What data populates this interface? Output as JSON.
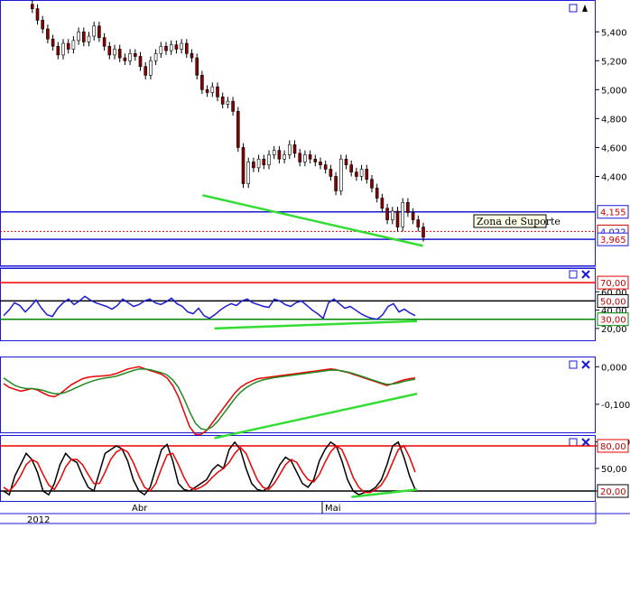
{
  "chart_data": [
    {
      "type": "candlestick",
      "panel": "price",
      "ylim": [
        3.86,
        5.62
      ],
      "yticks": [
        "5,400",
        "5,200",
        "5,000",
        "4,800",
        "4,600",
        "4,400"
      ],
      "y_tick_values": [
        5.4,
        5.2,
        5.0,
        4.8,
        4.6,
        4.4
      ],
      "series": [
        {
          "name": "close",
          "values": [
            5.56,
            5.48,
            5.42,
            5.35,
            5.3,
            5.24,
            5.32,
            5.28,
            5.34,
            5.4,
            5.33,
            5.37,
            5.44,
            5.36,
            5.3,
            5.24,
            5.28,
            5.22,
            5.2,
            5.25,
            5.23,
            5.16,
            5.1,
            5.2,
            5.25,
            5.3,
            5.27,
            5.31,
            5.28,
            5.32,
            5.25,
            5.22,
            5.1,
            5.0,
            4.98,
            5.02,
            4.95,
            4.9,
            4.92,
            4.85,
            4.6,
            4.35,
            4.5,
            4.46,
            4.52,
            4.48,
            4.55,
            4.58,
            4.52,
            4.55,
            4.62,
            4.56,
            4.5,
            4.55,
            4.52,
            4.5,
            4.48,
            4.45,
            4.4,
            4.3,
            4.52,
            4.48,
            4.43,
            4.4,
            4.45,
            4.38,
            4.32,
            4.25,
            4.18,
            4.1,
            4.16,
            4.05,
            4.22,
            4.15,
            4.1,
            4.05,
            3.98
          ]
        }
      ],
      "hlines": [
        {
          "name": "resistencia",
          "value": 4.155,
          "label": "4,155",
          "color": "#1a1ad6"
        },
        {
          "name": "ultimo",
          "value": 4.02,
          "label": "4,022",
          "color": "#cc0000",
          "style": "dotted"
        },
        {
          "name": "suporte",
          "value": 3.965,
          "label": "3,965",
          "color": "#1a1ad6"
        }
      ],
      "trendline": {
        "x": [
          0.34,
          0.71
        ],
        "y": [
          4.27,
          3.92
        ],
        "color": "#33dd33"
      },
      "annotation": "Zona de Suporte"
    },
    {
      "type": "line",
      "panel": "rsi",
      "ylim": [
        12,
        76
      ],
      "yticks": [
        "60,00",
        "40,00",
        "20,00"
      ],
      "y_tick_values": [
        60,
        40,
        20
      ],
      "hlines": [
        {
          "value": 70,
          "label": "70,00",
          "color": "#ee0000"
        },
        {
          "value": 50,
          "label": "50,00",
          "color": "#000000"
        },
        {
          "value": 30,
          "label": "30,00",
          "color": "#008800"
        }
      ],
      "series": [
        {
          "name": "rsi",
          "values": [
            34,
            40,
            48,
            45,
            38,
            44,
            51,
            42,
            35,
            33,
            42,
            48,
            52,
            46,
            50,
            55,
            51,
            48,
            46,
            44,
            41,
            45,
            52,
            48,
            44,
            46,
            50,
            52,
            48,
            46,
            49,
            53,
            47,
            44,
            38,
            36,
            42,
            34,
            31,
            35,
            40,
            44,
            47,
            45,
            50,
            52,
            48,
            46,
            44,
            43,
            52,
            50,
            46,
            44,
            48,
            50,
            45,
            40,
            36,
            31,
            48,
            52,
            47,
            42,
            44,
            40,
            36,
            33,
            31,
            30,
            35,
            44,
            47,
            38,
            41,
            37,
            34
          ]
        }
      ],
      "trendline": {
        "x": [
          0.36,
          0.7
        ],
        "y": [
          20,
          28
        ],
        "color": "#33dd33"
      }
    },
    {
      "type": "line",
      "panel": "macd",
      "ylim": [
        -0.23,
        0.02
      ],
      "yticks": [
        "0,000",
        "-0,100",
        "-0,200"
      ],
      "y_tick_values": [
        0,
        -0.1,
        -0.2
      ],
      "series": [
        {
          "name": "macd",
          "values": [
            -0.045,
            -0.055,
            -0.06,
            -0.065,
            -0.062,
            -0.058,
            -0.062,
            -0.07,
            -0.077,
            -0.08,
            -0.072,
            -0.06,
            -0.048,
            -0.04,
            -0.032,
            -0.028,
            -0.026,
            -0.025,
            -0.024,
            -0.022,
            -0.018,
            -0.012,
            -0.006,
            -0.003,
            0,
            -0.005,
            -0.01,
            -0.015,
            -0.02,
            -0.03,
            -0.05,
            -0.08,
            -0.12,
            -0.16,
            -0.18,
            -0.18,
            -0.17,
            -0.15,
            -0.13,
            -0.11,
            -0.09,
            -0.07,
            -0.055,
            -0.045,
            -0.038,
            -0.032,
            -0.03,
            -0.028,
            -0.026,
            -0.024,
            -0.022,
            -0.02,
            -0.018,
            -0.016,
            -0.014,
            -0.012,
            -0.01,
            -0.008,
            -0.006,
            -0.008,
            -0.012,
            -0.015,
            -0.02,
            -0.025,
            -0.03,
            -0.035,
            -0.04,
            -0.045,
            -0.05,
            -0.045,
            -0.04,
            -0.035,
            -0.032,
            -0.03
          ],
          "color": "#ee0000"
        },
        {
          "name": "sinal",
          "values": [
            -0.03,
            -0.04,
            -0.05,
            -0.055,
            -0.058,
            -0.058,
            -0.06,
            -0.063,
            -0.068,
            -0.072,
            -0.072,
            -0.068,
            -0.062,
            -0.055,
            -0.048,
            -0.042,
            -0.037,
            -0.033,
            -0.03,
            -0.028,
            -0.025,
            -0.02,
            -0.015,
            -0.01,
            -0.006,
            -0.006,
            -0.008,
            -0.012,
            -0.016,
            -0.022,
            -0.035,
            -0.055,
            -0.085,
            -0.12,
            -0.15,
            -0.165,
            -0.168,
            -0.16,
            -0.145,
            -0.125,
            -0.105,
            -0.085,
            -0.068,
            -0.056,
            -0.047,
            -0.04,
            -0.035,
            -0.032,
            -0.029,
            -0.027,
            -0.025,
            -0.023,
            -0.021,
            -0.019,
            -0.017,
            -0.015,
            -0.013,
            -0.011,
            -0.009,
            -0.009,
            -0.011,
            -0.014,
            -0.018,
            -0.023,
            -0.028,
            -0.033,
            -0.038,
            -0.043,
            -0.047,
            -0.046,
            -0.043,
            -0.039,
            -0.036,
            -0.033
          ],
          "color": "#228822"
        }
      ],
      "trendline": {
        "x": [
          0.36,
          0.7
        ],
        "y": [
          -0.19,
          -0.072
        ],
        "color": "#33dd33"
      }
    },
    {
      "type": "line",
      "panel": "stochastic",
      "ylim": [
        8,
        92
      ],
      "yticks": [
        "80,00",
        "50,00",
        "20,00"
      ],
      "y_tick_values": [
        80,
        50,
        20
      ],
      "hlines": [
        {
          "value": 80,
          "label": "80,00",
          "color": "#ee0000"
        },
        {
          "value": 20,
          "label": "20,00",
          "color": "#000000"
        }
      ],
      "series": [
        {
          "name": "%K",
          "values": [
            20,
            15,
            40,
            55,
            70,
            62,
            45,
            20,
            15,
            30,
            55,
            70,
            62,
            58,
            40,
            25,
            20,
            45,
            70,
            75,
            80,
            76,
            60,
            35,
            20,
            15,
            25,
            50,
            75,
            82,
            60,
            30,
            22,
            20,
            25,
            30,
            35,
            48,
            55,
            50,
            75,
            85,
            75,
            50,
            30,
            22,
            20,
            25,
            40,
            55,
            65,
            60,
            45,
            30,
            25,
            35,
            60,
            75,
            85,
            80,
            60,
            35,
            20,
            15,
            18,
            20,
            25,
            35,
            55,
            80,
            85,
            65,
            40,
            22
          ],
          "color": "#000000"
        },
        {
          "name": "%D",
          "values": [
            25,
            20,
            28,
            40,
            55,
            62,
            58,
            42,
            28,
            22,
            35,
            52,
            62,
            62,
            55,
            42,
            30,
            30,
            45,
            62,
            72,
            76,
            72,
            58,
            40,
            25,
            20,
            30,
            50,
            68,
            70,
            55,
            38,
            25,
            22,
            25,
            30,
            38,
            45,
            50,
            58,
            70,
            78,
            70,
            52,
            35,
            25,
            22,
            30,
            42,
            55,
            62,
            58,
            45,
            35,
            32,
            42,
            58,
            72,
            80,
            75,
            58,
            38,
            25,
            18,
            18,
            22,
            28,
            40,
            58,
            75,
            80,
            65,
            45
          ],
          "color": "#ee0000"
        }
      ],
      "trendline": {
        "x": [
          0.59,
          0.7
        ],
        "y": [
          12,
          22
        ],
        "color": "#33dd33"
      }
    }
  ],
  "x_axis": {
    "year_label": "2012",
    "month_labels": [
      {
        "label": "Abr",
        "pos": 0.236
      },
      {
        "label": "Mai",
        "pos": 0.548
      }
    ]
  },
  "annotation": {
    "text": "Zona de Suporte"
  },
  "colors": {
    "blue": "#1a1ad6",
    "red": "#ee0000",
    "green": "#33dd33",
    "dark_green": "#008800"
  }
}
